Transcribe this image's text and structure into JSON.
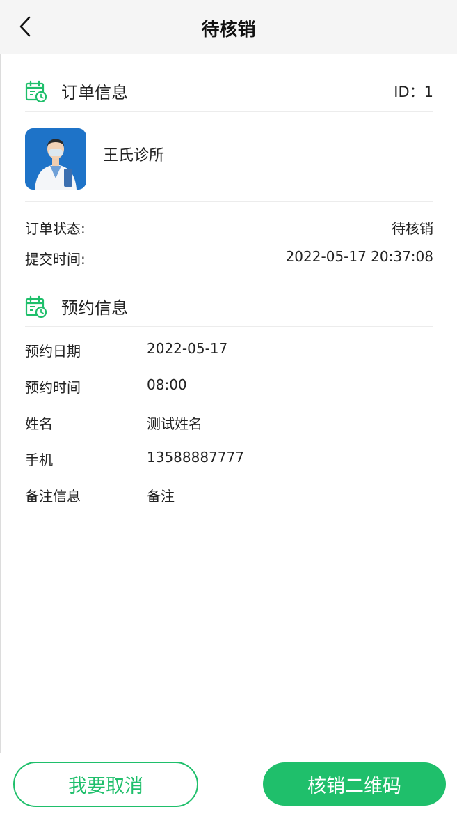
{
  "header": {
    "title": "待核销"
  },
  "order_section": {
    "title": "订单信息",
    "id_text": "ID：1"
  },
  "clinic": {
    "name": "王氏诊所"
  },
  "order_details": [
    {
      "label": "订单状态:",
      "value": "待核销"
    },
    {
      "label": "提交时间:",
      "value": "2022-05-17 20:37:08"
    }
  ],
  "appointment_section": {
    "title": "预约信息"
  },
  "appointment_details": [
    {
      "label": "预约日期",
      "value": "2022-05-17"
    },
    {
      "label": "预约时间",
      "value": "08:00"
    },
    {
      "label": "姓名",
      "value": "测试姓名"
    },
    {
      "label": "手机",
      "value": "13588887777"
    },
    {
      "label": "备注信息",
      "value": "备注"
    }
  ],
  "actions": {
    "cancel_label": "我要取消",
    "qr_label": "核销二维码"
  },
  "colors": {
    "accent": "#1fbf6b",
    "header_bg": "#f5f5f5",
    "avatar_bg": "#1e73c8"
  }
}
